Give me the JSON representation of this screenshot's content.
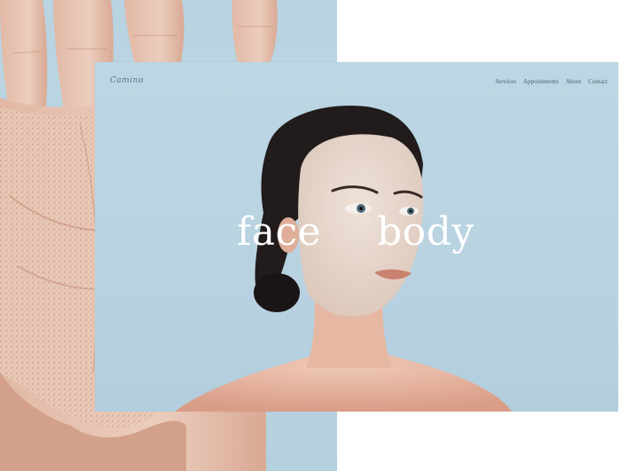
{
  "site": {
    "logo": "Camino",
    "nav": {
      "services": "Services",
      "appointments": "Appointments",
      "about": "About",
      "contact": "Contact"
    },
    "hero": {
      "face": "face",
      "body": "body"
    }
  },
  "colors": {
    "background": "#ffffff",
    "sky_blue": "#b9d3e1",
    "text_white": "#ffffff",
    "nav_text": "#4f6470",
    "clay_mask": "#e7d6cb",
    "skin": "#e4b8a4",
    "hair": "#1f1a1a"
  }
}
